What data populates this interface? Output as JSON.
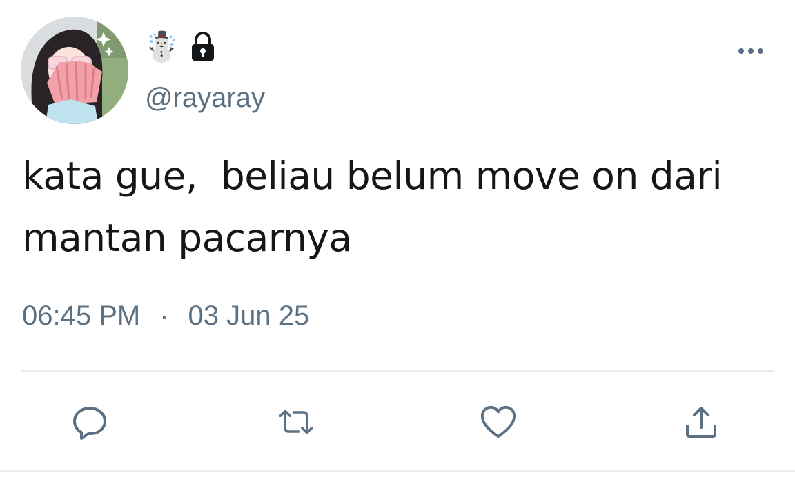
{
  "tweet": {
    "display_name_emoji": "☃️",
    "handle": "@rayaray",
    "text": "kata gue,  beliau belum move on dari\nmantan pacarnya",
    "time": "06:45 PM",
    "separator": "·",
    "date": "03 Jun 25"
  },
  "icons": {
    "lock": "lock-icon",
    "more": "more-horizontal-icon",
    "reply": "reply-icon",
    "retweet": "retweet-icon",
    "like": "heart-icon",
    "share": "share-icon"
  },
  "colors": {
    "text_primary": "#14171a",
    "text_secondary": "#5b7083",
    "icon": "#5b7083",
    "divider": "#e6ecf0"
  }
}
